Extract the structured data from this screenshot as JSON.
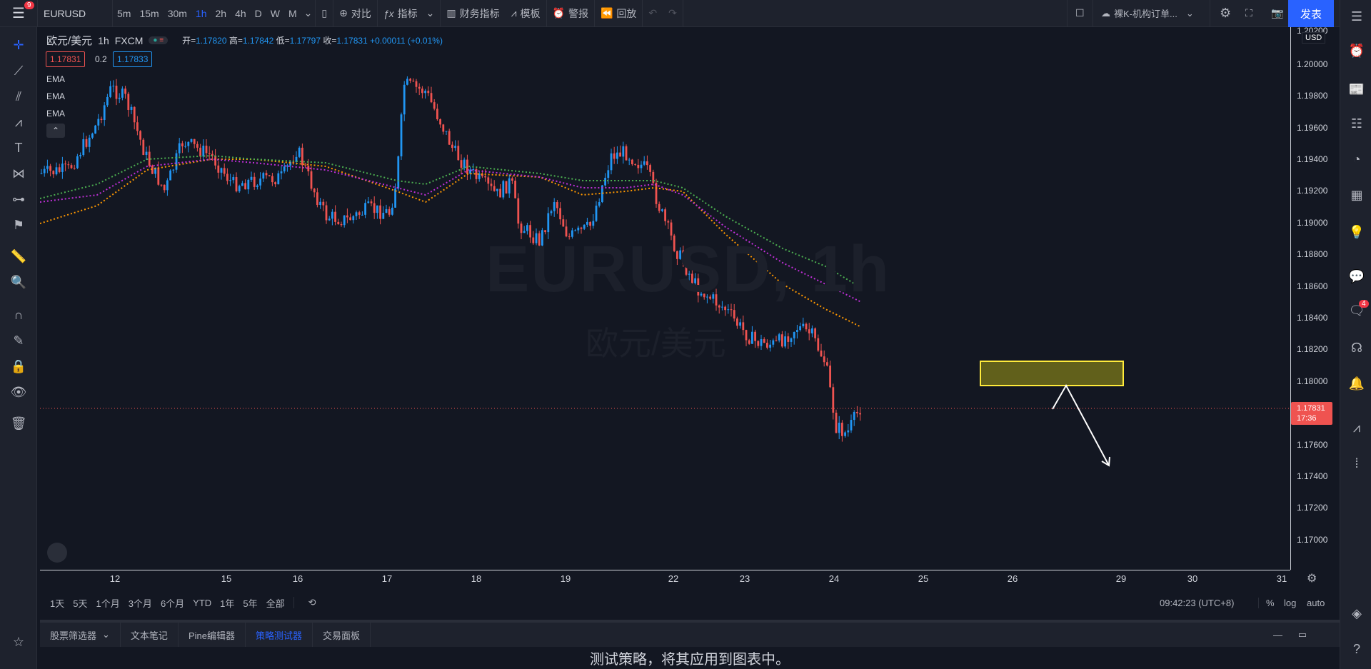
{
  "toolbar": {
    "symbol": "EURUSD",
    "intervals": [
      "5m",
      "15m",
      "30m",
      "1h",
      "2h",
      "4h",
      "D",
      "W",
      "M"
    ],
    "active_interval": "1h",
    "compare_label": "对比",
    "indicators_label": "指标",
    "financials_label": "财务指标",
    "templates_label": "模板",
    "alert_label": "警报",
    "replay_label": "回放",
    "layout_name": "裸K-机构订单...",
    "publish_label": "发表",
    "notification_count": "9"
  },
  "legend": {
    "pair": "欧元/美元",
    "interval": "1h",
    "source": "FXCM",
    "open_label": "开=",
    "open": "1.17820",
    "high_label": "高=",
    "high": "1.17842",
    "low_label": "低=",
    "low": "1.17797",
    "close_label": "收=",
    "close": "1.17831",
    "change": "+0.00011 (+0.01%)",
    "bid": "1.17831",
    "spread": "0.2",
    "ask": "1.17833",
    "ema_labels": [
      "EMA",
      "EMA",
      "EMA"
    ]
  },
  "watermark": {
    "symbol": "EURUSD, 1h",
    "name": "欧元/美元"
  },
  "price_axis": {
    "currency": "USD",
    "ticks": [
      "1.20200",
      "1.20000",
      "1.19800",
      "1.19600",
      "1.19400",
      "1.19200",
      "1.19000",
      "1.18800",
      "1.18600",
      "1.18400",
      "1.18200",
      "1.18000",
      "1.17600",
      "1.17400",
      "1.17200",
      "1.17000"
    ],
    "last_price": "1.17831",
    "countdown": "17:36"
  },
  "time_axis": {
    "ticks": [
      "12",
      "15",
      "16",
      "17",
      "18",
      "19",
      "22",
      "23",
      "24",
      "25",
      "26",
      "29",
      "30",
      "31"
    ]
  },
  "range_bar": {
    "ranges": [
      "1天",
      "5天",
      "1个月",
      "3个月",
      "6个月",
      "YTD",
      "1年",
      "5年",
      "全部"
    ],
    "clock": "09:42:23 (UTC+8)",
    "percent": "%",
    "log": "log",
    "auto": "auto"
  },
  "bottom_panel": {
    "tabs": [
      "股票筛选器",
      "文本笔记",
      "Pine编辑器",
      "策略测试器",
      "交易面板"
    ],
    "active_tab": "策略测试器",
    "message": "测试策略，将其应用到图表中。"
  },
  "right_badge_count": "4",
  "colors": {
    "up": "#2196f3",
    "down": "#ef5350",
    "ema_fast": "#ff9800",
    "ema_mid": "#c02fd8",
    "ema_slow": "#4caf50",
    "zone": "#ffeb3b"
  }
}
